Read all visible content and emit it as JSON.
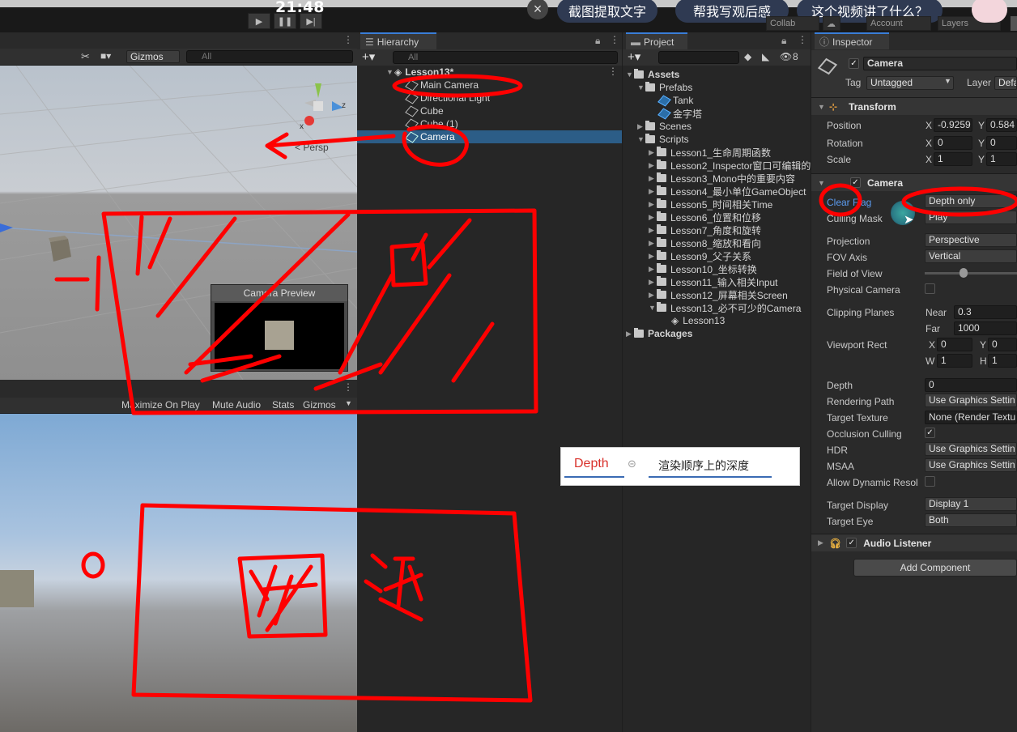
{
  "overlay": {
    "clock": "21:48",
    "pills": [
      "截图提取文字",
      "帮我写观后感",
      "这个视频讲了什么？"
    ],
    "collab": "Collab",
    "account": "Account",
    "layers": "Layers"
  },
  "scene": {
    "gizmos": "Gizmos",
    "search_placeholder": "All",
    "persp": "< Persp",
    "axis_x": "x",
    "axis_z": "z",
    "camera_preview": "Camera Preview",
    "game_toolbar": [
      "Maximize On Play",
      "Mute Audio",
      "Stats",
      "Gizmos"
    ]
  },
  "hierarchy": {
    "tab": "Hierarchy",
    "search_placeholder": "All",
    "scene_name": "Lesson13*",
    "items": [
      "Main Camera",
      "Directional Light",
      "Cube",
      "Cube (1)",
      "Camera"
    ]
  },
  "project": {
    "tab": "Project",
    "hidden_count": "8",
    "assets": "Assets",
    "prefabs": "Prefabs",
    "prefab_items": [
      "Tank",
      "金字塔"
    ],
    "scenes": "Scenes",
    "scripts": "Scripts",
    "lessons": [
      "Lesson1_生命周期函数",
      "Lesson2_Inspector窗口可编辑的",
      "Lesson3_Mono中的重要内容",
      "Lesson4_最小单位GameObject",
      "Lesson5_时间相关Time",
      "Lesson6_位置和位移",
      "Lesson7_角度和旋转",
      "Lesson8_缩放和看向",
      "Lesson9_父子关系",
      "Lesson10_坐标转换",
      "Lesson11_输入相关Input",
      "Lesson12_屏幕相关Screen",
      "Lesson13_必不可少的Camera"
    ],
    "lesson13_child": "Lesson13",
    "packages": "Packages"
  },
  "inspector": {
    "tab": "Inspector",
    "object_name": "Camera",
    "tag_label": "Tag",
    "tag_value": "Untagged",
    "layer_label": "Layer",
    "layer_value": "Defa",
    "transform": {
      "title": "Transform",
      "position_label": "Position",
      "pos_x": "-0.9259",
      "pos_y": "0.584",
      "rotation_label": "Rotation",
      "rot_x": "0",
      "rot_y": "0",
      "scale_label": "Scale",
      "scale_x": "1",
      "scale_y": "1"
    },
    "camera": {
      "title": "Camera",
      "clear_flags_label": "Clear Flag",
      "clear_flags_value": "Depth only",
      "culling_mask_label": "Culling Mask",
      "culling_mask_value": "Play",
      "projection_label": "Projection",
      "projection_value": "Perspective",
      "fov_axis_label": "FOV Axis",
      "fov_axis_value": "Vertical",
      "fov_label": "Field of View",
      "fov_fraction": 0.42,
      "physical_label": "Physical Camera",
      "clipping_label": "Clipping Planes",
      "near_label": "Near",
      "near_value": "0.3",
      "far_label": "Far",
      "far_value": "1000",
      "viewport_label": "Viewport Rect",
      "vp_x": "0",
      "vp_y": "0",
      "vp_w": "1",
      "vp_h": "1",
      "depth_label": "Depth",
      "depth_value": "0",
      "render_path_label": "Rendering Path",
      "render_path_value": "Use Graphics Settin",
      "target_tex_label": "Target Texture",
      "target_tex_value": "None (Render Textu",
      "occlusion_label": "Occlusion Culling",
      "hdr_label": "HDR",
      "hdr_value": "Use Graphics Settin",
      "msaa_label": "MSAA",
      "msaa_value": "Use Graphics Settin",
      "dyn_res_label": "Allow Dynamic Resol",
      "target_display_label": "Target Display",
      "target_display_value": "Display 1",
      "target_eye_label": "Target Eye",
      "target_eye_value": "Both"
    },
    "audio_listener": "Audio Listener",
    "add_component": "Add Component"
  },
  "tooltip": {
    "word": "Depth",
    "translation": "渲染顺序上的深度"
  },
  "annotations": {
    "left_mark": "一",
    "small_mark": "o",
    "transparent": "透"
  },
  "colors": {
    "annotation_red": "#ff0000",
    "accent_blue": "#3a7ed8",
    "selection": "#2c5d87"
  }
}
